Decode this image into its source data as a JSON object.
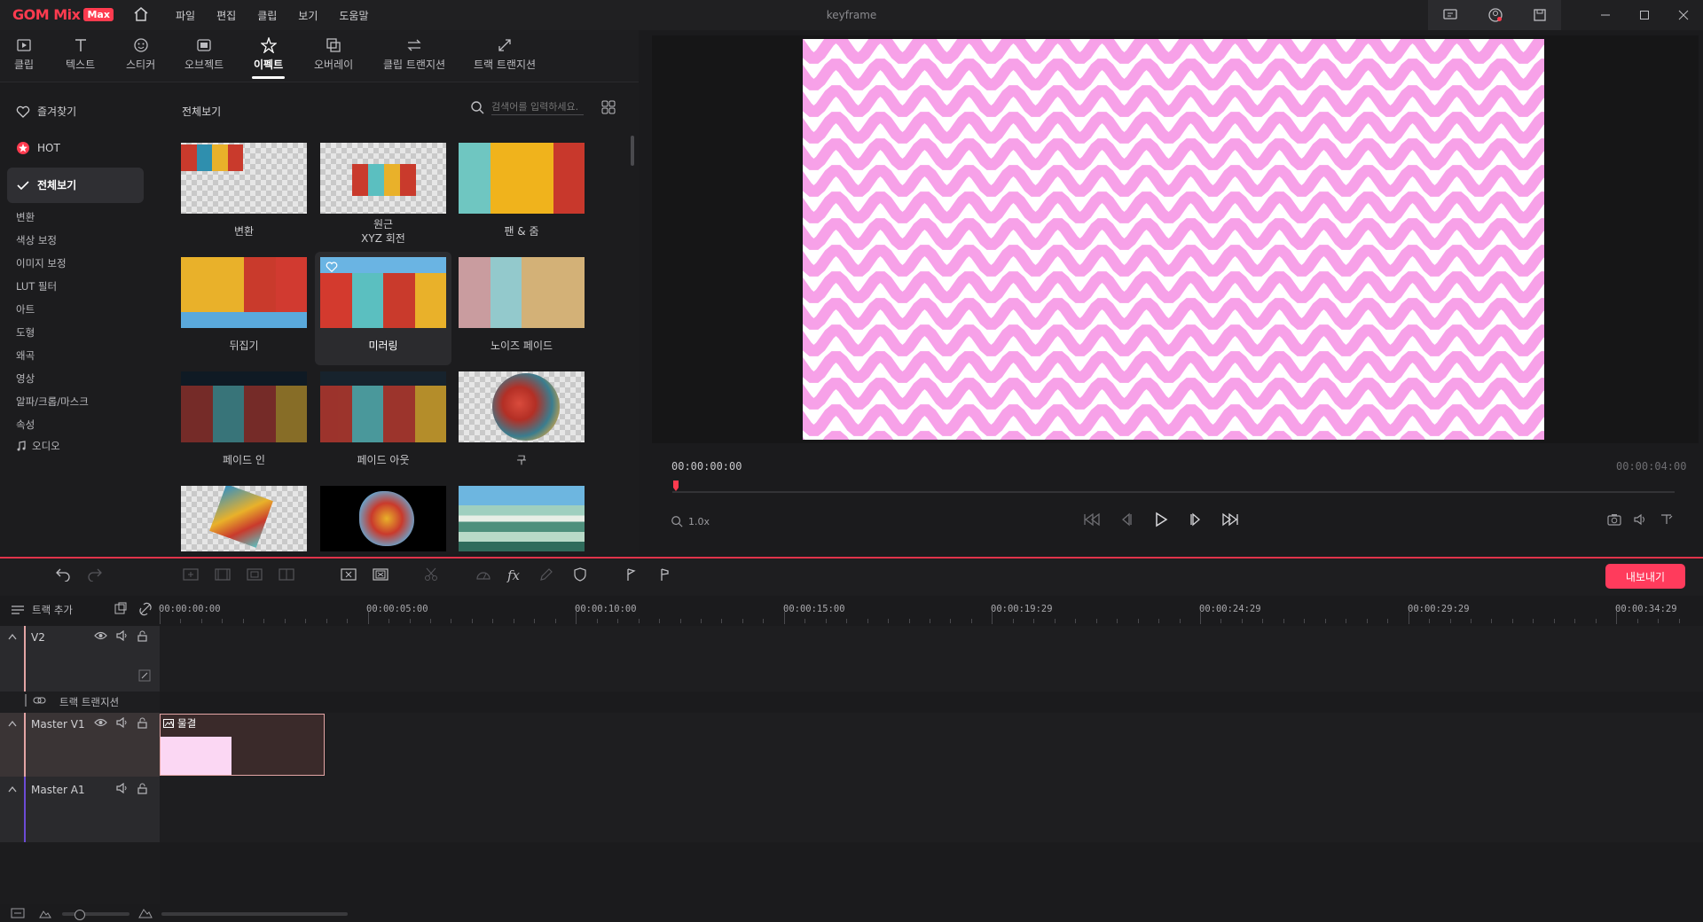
{
  "app": {
    "logo_word": "GOM Mix",
    "logo_badge": "Max",
    "window_title": "keyframe",
    "menu": [
      "파일",
      "편집",
      "클립",
      "보기",
      "도움말"
    ]
  },
  "tabs": [
    {
      "label": "클립",
      "icon": "clip-icon"
    },
    {
      "label": "텍스트",
      "icon": "text-icon"
    },
    {
      "label": "스티커",
      "icon": "sticker-icon"
    },
    {
      "label": "오브젝트",
      "icon": "object-icon"
    },
    {
      "label": "이펙트",
      "icon": "effect-icon",
      "active": true
    },
    {
      "label": "오버레이",
      "icon": "overlay-icon"
    },
    {
      "label": "클립 트랜지션",
      "icon": "clip-transition-icon"
    },
    {
      "label": "트랙 트랜지션",
      "icon": "track-transition-icon"
    }
  ],
  "categories": {
    "favorites": "즐겨찾기",
    "hot": "HOT",
    "all": "전체보기",
    "sub": [
      "변환",
      "색상 보정",
      "이미지 보정",
      "LUT 필터",
      "아트",
      "도형",
      "왜곡",
      "영상",
      "알파/크롭/마스크",
      "속성"
    ],
    "audio": "오디오"
  },
  "grid": {
    "title": "전체보기",
    "search_placeholder": "검색어를 입력하세요.",
    "effects": [
      {
        "label": "변환"
      },
      {
        "label": "원근\nXYZ 회전"
      },
      {
        "label": "팬 & 줌"
      },
      {
        "label": "뒤집기"
      },
      {
        "label": "미러링",
        "selected": true
      },
      {
        "label": "노이즈 페이드"
      },
      {
        "label": "페이드 인"
      },
      {
        "label": "페이드 아웃"
      },
      {
        "label": "구"
      },
      {
        "label": ""
      },
      {
        "label": ""
      },
      {
        "label": ""
      }
    ]
  },
  "preview": {
    "current_time": "00:00:00:00",
    "end_time": "00:00:04:00",
    "zoom": "1.0x"
  },
  "timeline": {
    "add_track": "트랙 추가",
    "export_label": "내보내기",
    "ruler": [
      "00:00:00:00",
      "00:00:05:00",
      "00:00:10:00",
      "00:00:15:00",
      "00:00:19:29",
      "00:00:24:29",
      "00:00:29:29",
      "00:00:34:29"
    ],
    "tracks": {
      "v2": "V2",
      "transition": "트랙 트랜지션",
      "master_v1": "Master V1",
      "master_a1": "Master A1"
    },
    "clip_label": "물결"
  },
  "colors": {
    "accent": "#ff3b5c",
    "wave_pink": "#f7a1e8",
    "selected_tab": "#ffffff"
  }
}
